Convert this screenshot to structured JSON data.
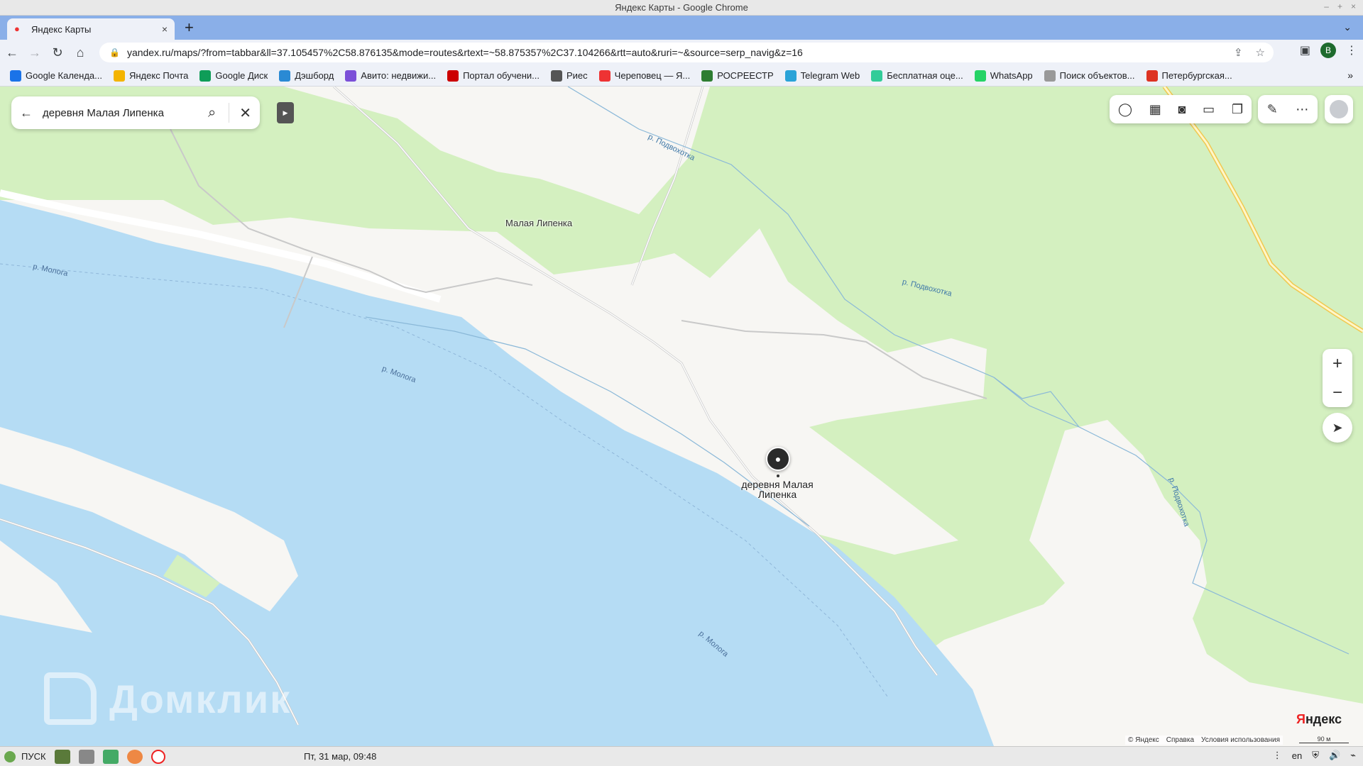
{
  "window": {
    "title": "Яндекс Карты - Google Chrome",
    "controls": [
      "–",
      "+",
      "×"
    ]
  },
  "tab": {
    "title": "Яндекс Карты",
    "close": "×",
    "new": "+",
    "menu": "⌄"
  },
  "toolbar": {
    "url": "yandex.ru/maps/?from=tabbar&ll=37.105457%2C58.876135&mode=routes&rtext=~58.875357%2C37.104266&rtt=auto&ruri=~&source=serp_navig&z=16",
    "profile_letter": "B"
  },
  "bookmarks": [
    {
      "label": "Google Календа...",
      "color": "#1a73e8",
      "icon": "calendar-icon"
    },
    {
      "label": "Яндекс Почта",
      "color": "#f4b400",
      "icon": "mail-icon"
    },
    {
      "label": "Google Диск",
      "color": "#0f9d58",
      "icon": "drive-icon"
    },
    {
      "label": "Дэшборд",
      "color": "#2a8ad4",
      "icon": "dashboard-icon"
    },
    {
      "label": "Авито: недвижи...",
      "color": "#7b4fd8",
      "icon": "avito-icon"
    },
    {
      "label": "Портал обучени...",
      "color": "#c00",
      "icon": "portal-icon"
    },
    {
      "label": "Риес",
      "color": "#555",
      "icon": "ries-icon"
    },
    {
      "label": "Череповец — Я...",
      "color": "#e33",
      "icon": "pin-icon"
    },
    {
      "label": "РОСРЕЕСТР",
      "color": "#2e7d32",
      "icon": "rosreestr-icon"
    },
    {
      "label": "Telegram Web",
      "color": "#2aa3d8",
      "icon": "telegram-icon"
    },
    {
      "label": "Бесплатная оце...",
      "color": "#3c9",
      "icon": "estimate-icon"
    },
    {
      "label": "WhatsApp",
      "color": "#25d366",
      "icon": "whatsapp-icon"
    },
    {
      "label": "Поиск объектов...",
      "color": "#999",
      "icon": "search-objects-icon"
    },
    {
      "label": "Петербургская...",
      "color": "#d32",
      "icon": "spb-icon"
    }
  ],
  "bookmarks_more": "»",
  "search": {
    "query": "деревня Малая Липенка"
  },
  "map": {
    "place_label": "Малая Липенка",
    "pin_label": "деревня Малая Липенка",
    "rivers": [
      "р. Молога",
      "р. Молога",
      "р. Молога"
    ],
    "streams": [
      "р. Подвохотка",
      "р. Подвохотка",
      "р. Подвохотка"
    ],
    "watermark": "Домклик",
    "logo_ya": "Я",
    "logo_rest": "ндекс",
    "copyright": [
      "© Яндекс",
      "Справка",
      "Условия использования"
    ],
    "scale": "90 м",
    "zoom_in": "+",
    "zoom_out": "−"
  },
  "taskbar": {
    "start": "ПУСК",
    "clock": "Пт, 31 мар, 09:48",
    "lang": "en"
  }
}
